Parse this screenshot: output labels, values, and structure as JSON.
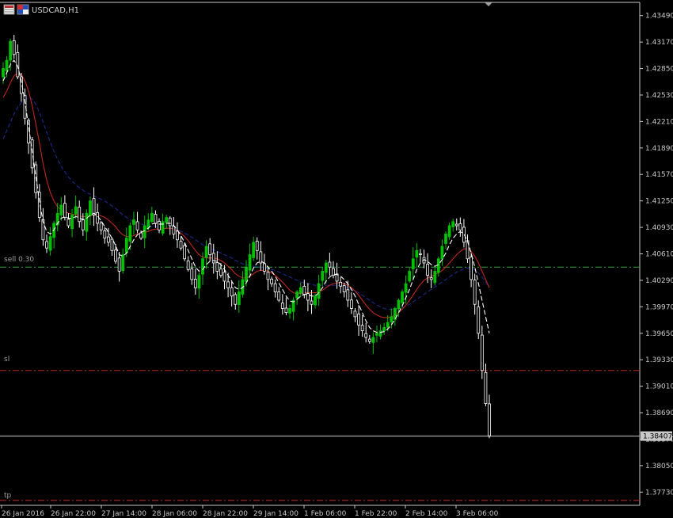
{
  "window": {
    "title": "USDCAD,H1"
  },
  "colors": {
    "background": "#000000",
    "axis": "#c8c8c8",
    "bull": "#00c000",
    "bear": "#ffffff",
    "ma_fast": "#ffffff",
    "ma_mid": "#c0281e",
    "ma_slow": "#1c2a8c",
    "sell_line": "#3aa04a",
    "sl_line": "#c0281e",
    "tp_line": "#c0281e",
    "bid_line": "#c8c8c8"
  },
  "chart_data": {
    "type": "candlestick",
    "symbol": "USDCAD",
    "timeframe": "H1",
    "ylim": [
      1.3757,
      1.4365
    ],
    "y_ticks": [
      "1.43490",
      "1.43170",
      "1.42850",
      "1.42530",
      "1.42210",
      "1.41890",
      "1.41570",
      "1.41250",
      "1.40930",
      "1.40610",
      "1.40290",
      "1.39970",
      "1.39650",
      "1.39330",
      "1.39010",
      "1.38690",
      "1.38370",
      "1.38050",
      "1.37730"
    ],
    "x_ticks": [
      "26 Jan 2016",
      "26 Jan 22:00",
      "27 Jan 14:00",
      "28 Jan 06:00",
      "28 Jan 22:00",
      "29 Jan 14:00",
      "1 Feb 06:00",
      "1 Feb 22:00",
      "2 Feb 14:00",
      "3 Feb 06:00"
    ],
    "current_price": "1.38407",
    "levels": [
      {
        "name": "sell 0.30",
        "price": 1.4045,
        "style": "dash-dot",
        "color": "#3aa04a"
      },
      {
        "name": "sl",
        "price": 1.392,
        "style": "dash-dot",
        "color": "#c0281e"
      },
      {
        "name": "tp",
        "price": 1.3763,
        "style": "dash-dot",
        "color": "#c0281e"
      }
    ],
    "close_series": [
      1.4285,
      1.4295,
      1.4318,
      1.4302,
      1.4275,
      1.4255,
      1.4225,
      1.4195,
      1.4165,
      1.4135,
      1.4105,
      1.4078,
      1.4068,
      1.4082,
      1.4098,
      1.411,
      1.412,
      1.4105,
      1.4095,
      1.4108,
      1.4118,
      1.41,
      1.409,
      1.411,
      1.4125,
      1.4108,
      1.4098,
      1.409,
      1.408,
      1.4075,
      1.4065,
      1.4052,
      1.404,
      1.406,
      1.408,
      1.4095,
      1.4102,
      1.409,
      1.408,
      1.4095,
      1.4102,
      1.411,
      1.4098,
      1.409,
      1.41,
      1.4105,
      1.4095,
      1.4085,
      1.4078,
      1.4068,
      1.4055,
      1.4042,
      1.403,
      1.402,
      1.4035,
      1.4055,
      1.407,
      1.406,
      1.405,
      1.404,
      1.4035,
      1.4028,
      1.402,
      1.401,
      1.4,
      1.4015,
      1.403,
      1.4045,
      1.406,
      1.4075,
      1.4065,
      1.405,
      1.404,
      1.403,
      1.4025,
      1.4015,
      1.4005,
      1.3995,
      1.399,
      1.3995,
      1.4005,
      1.4015,
      1.402,
      1.4012,
      1.4005,
      1.4,
      1.401,
      1.4025,
      1.404,
      1.405,
      1.4045,
      1.4035,
      1.4028,
      1.4022,
      1.4015,
      1.4005,
      1.3995,
      1.3985,
      1.3975,
      1.3968,
      1.396,
      1.3955,
      1.396,
      1.3965,
      1.3968,
      1.3972,
      1.3978,
      1.3985,
      1.3995,
      1.4005,
      1.4015,
      1.4025,
      1.404,
      1.4055,
      1.4065,
      1.406,
      1.405,
      1.4035,
      1.403,
      1.404,
      1.4055,
      1.407,
      1.4085,
      1.4095,
      1.41,
      1.4095,
      1.409,
      1.4075,
      1.4055,
      1.403,
      1.4,
      1.3965,
      1.392,
      1.388,
      1.3841
    ],
    "ma_fast_series": [
      1.427,
      1.428,
      1.429,
      1.4295,
      1.4288,
      1.427,
      1.4245,
      1.4215,
      1.4185,
      1.4155,
      1.4125,
      1.41,
      1.4088,
      1.4085,
      1.409,
      1.4098,
      1.4104,
      1.4106,
      1.4104,
      1.4104,
      1.4106,
      1.4105,
      1.4102,
      1.4104,
      1.4108,
      1.411,
      1.4107,
      1.4101,
      1.4094,
      1.4087,
      1.408,
      1.4071,
      1.406,
      1.4058,
      1.4062,
      1.407,
      1.4078,
      1.4084,
      1.4087,
      1.4089,
      1.4092,
      1.4097,
      1.4098,
      1.4097,
      1.4097,
      1.4098,
      1.4098,
      1.4095,
      1.409,
      1.4083,
      1.4075,
      1.4065,
      1.4055,
      1.4045,
      1.404,
      1.4042,
      1.4048,
      1.4052,
      1.4053,
      1.4052,
      1.4048,
      1.4042,
      1.4035,
      1.4028,
      1.402,
      1.4018,
      1.402,
      1.4026,
      1.4034,
      1.4044,
      1.405,
      1.4052,
      1.405,
      1.4045,
      1.404,
      1.4034,
      1.4026,
      1.4018,
      1.401,
      1.4004,
      1.4003,
      1.4006,
      1.401,
      1.4012,
      1.4012,
      1.401,
      1.401,
      1.4014,
      1.402,
      1.4028,
      1.4033,
      1.4036,
      1.4036,
      1.4034,
      1.403,
      1.4025,
      1.4018,
      1.401,
      1.4,
      1.399,
      1.398,
      1.3972,
      1.3968,
      1.3966,
      1.3966,
      1.3967,
      1.397,
      1.3975,
      1.3982,
      1.399,
      1.3998,
      1.4008,
      1.4018,
      1.403,
      1.4042,
      1.405,
      1.4054,
      1.4052,
      1.4048,
      1.4046,
      1.4048,
      1.4054,
      1.4062,
      1.4072,
      1.408,
      1.4085,
      1.4088,
      1.4085,
      1.4076,
      1.4062,
      1.4045,
      1.4025,
      1.4005,
      1.3985,
      1.3965
    ],
    "ma_mid_series": [
      1.425,
      1.4258,
      1.4268,
      1.4276,
      1.428,
      1.4278,
      1.427,
      1.4258,
      1.424,
      1.4218,
      1.4195,
      1.417,
      1.415,
      1.4135,
      1.4125,
      1.4118,
      1.4114,
      1.4112,
      1.411,
      1.4109,
      1.4108,
      1.4107,
      1.4106,
      1.4106,
      1.4107,
      1.4108,
      1.4108,
      1.4107,
      1.4105,
      1.4102,
      1.4098,
      1.4094,
      1.4088,
      1.4084,
      1.4082,
      1.4082,
      1.4083,
      1.4085,
      1.4086,
      1.4087,
      1.4088,
      1.409,
      1.4091,
      1.4091,
      1.4091,
      1.4092,
      1.4092,
      1.4091,
      1.4089,
      1.4086,
      1.4082,
      1.4077,
      1.4071,
      1.4065,
      1.406,
      1.4057,
      1.4056,
      1.4056,
      1.4056,
      1.4055,
      1.4053,
      1.405,
      1.4046,
      1.4042,
      1.4037,
      1.4034,
      1.4032,
      1.4032,
      1.4034,
      1.4037,
      1.404,
      1.4041,
      1.4041,
      1.404,
      1.4038,
      1.4035,
      1.4031,
      1.4027,
      1.4022,
      1.4017,
      1.4014,
      1.4013,
      1.4013,
      1.4014,
      1.4014,
      1.4014,
      1.4014,
      1.4015,
      1.4017,
      1.402,
      1.4023,
      1.4025,
      1.4026,
      1.4026,
      1.4025,
      1.4023,
      1.402,
      1.4016,
      1.4011,
      1.4005,
      1.3999,
      1.3994,
      1.399,
      1.3987,
      1.3985,
      1.3984,
      1.3984,
      1.3985,
      1.3987,
      1.399,
      1.3994,
      1.3999,
      1.4005,
      1.4011,
      1.4018,
      1.4024,
      1.4029,
      1.4032,
      1.4034,
      1.4036,
      1.4038,
      1.4041,
      1.4045,
      1.405,
      1.4055,
      1.406,
      1.4064,
      1.4067,
      1.4067,
      1.4064,
      1.4058,
      1.405,
      1.404,
      1.403,
      1.402
    ],
    "ma_slow_series": [
      1.42,
      1.421,
      1.422,
      1.423,
      1.4238,
      1.4244,
      1.4248,
      1.425,
      1.4248,
      1.4242,
      1.4232,
      1.422,
      1.4208,
      1.4196,
      1.4185,
      1.4175,
      1.4167,
      1.416,
      1.4154,
      1.4149,
      1.4145,
      1.4141,
      1.4138,
      1.4135,
      1.4133,
      1.4131,
      1.4129,
      1.4127,
      1.4125,
      1.4122,
      1.4119,
      1.4116,
      1.4112,
      1.4108,
      1.4105,
      1.4102,
      1.41,
      1.4098,
      1.4097,
      1.4096,
      1.4095,
      1.4094,
      1.4094,
      1.4093,
      1.4093,
      1.4092,
      1.4092,
      1.4091,
      1.409,
      1.4088,
      1.4086,
      1.4084,
      1.4081,
      1.4078,
      1.4075,
      1.4072,
      1.407,
      1.4068,
      1.4066,
      1.4064,
      1.4062,
      1.406,
      1.4058,
      1.4056,
      1.4053,
      1.4051,
      1.4049,
      1.4048,
      1.4047,
      1.4046,
      1.4046,
      1.4045,
      1.4044,
      1.4043,
      1.4042,
      1.4041,
      1.4039,
      1.4037,
      1.4035,
      1.4033,
      1.4031,
      1.4029,
      1.4027,
      1.4026,
      1.4025,
      1.4024,
      1.4023,
      1.4023,
      1.4023,
      1.4023,
      1.4023,
      1.4023,
      1.4023,
      1.4022,
      1.4021,
      1.402,
      1.4018,
      1.4016,
      1.4014,
      1.4011,
      1.4008,
      1.4005,
      1.4002,
      1.3999,
      1.3997,
      1.3995,
      1.3994,
      1.3994,
      1.3994,
      1.3995,
      1.3996,
      1.3998,
      1.4,
      1.4003,
      1.4006,
      1.4009,
      1.4012,
      1.4015,
      1.4018,
      1.4021,
      1.4024,
      1.4027,
      1.403,
      1.4033,
      1.4036,
      1.4039,
      1.4041,
      1.4043,
      1.4044,
      1.4044,
      1.4042,
      1.4038,
      1.4033,
      1.4027,
      1.402
    ]
  }
}
